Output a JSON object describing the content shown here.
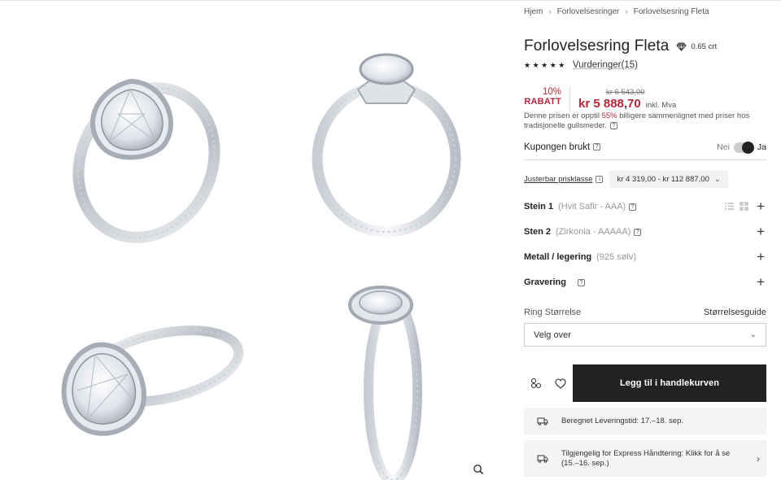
{
  "breadcrumb": [
    "Hjem",
    "Forlovelsesringer",
    "Forlovelsesring Fleta"
  ],
  "product": {
    "title": "Forlovelsesring Fleta",
    "carat": "0.65 crt",
    "rating_stars": 5,
    "reviews_label": "Vurderinger(15)"
  },
  "price": {
    "discount_pct": "10%",
    "discount_label": "RABATT",
    "old": "kr 6 543,00",
    "current": "kr 5 888,70",
    "vat": "inkl. Mva",
    "note_before": "Denne prisen er opptil ",
    "note_pct": "55%",
    "note_after": " billigere sammenlignet med priser hos tradisjonelle gullsmeder."
  },
  "coupon": {
    "label": "Kupongen brukt",
    "off": "Nei",
    "on": "Ja"
  },
  "adjustable": {
    "label": "Justerbar prisklasse",
    "range": "kr 4 319,00 - kr 112 887,00"
  },
  "options": [
    {
      "name": "Stein 1",
      "value": "(Hvit Safir - AAA)"
    },
    {
      "name": "Sten 2",
      "value": "(Zirkonia - AAAAA)"
    },
    {
      "name": "Metall / legering",
      "value": "(925 sølv)"
    },
    {
      "name": "Gravering",
      "value": ""
    }
  ],
  "ring_size": {
    "label": "Ring Størrelse",
    "guide": "Størrelsesguide",
    "placeholder": "Velg over"
  },
  "cart_button": "Legg til i handlekurven",
  "delivery": {
    "estimate": "Beregnet Leveringstid: 17.–18. sep.",
    "express": "Tilgjengelig for Express Håndtering: Klikk for å se (15.–16. sep.)"
  },
  "colors": {
    "accent_red": "#b0283a",
    "dark": "#222222",
    "info_bg": "#f4f4f4"
  }
}
